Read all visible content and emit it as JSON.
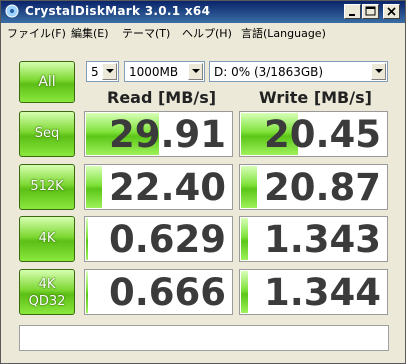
{
  "window": {
    "title": "CrystalDiskMark  3.0.1 x64"
  },
  "menu": [
    {
      "label": "ファイル(F)"
    },
    {
      "label": "編集(E)"
    },
    {
      "label": "テーマ(T)"
    },
    {
      "label": "ヘルプ(H)"
    },
    {
      "label": "言語(Language)"
    }
  ],
  "controls": {
    "all_label": "All",
    "count": "5",
    "size": "1000MB",
    "drive": "D: 0% (3/1863GB)"
  },
  "headers": {
    "read": "Read [MB/s]",
    "write": "Write [MB/s]"
  },
  "rows": [
    {
      "label": "Seq",
      "read": "29.91",
      "write": "20.45",
      "read_fill": 0.51,
      "write_fill": 0.4
    },
    {
      "label": "512K",
      "read": "22.40",
      "write": "20.87",
      "read_fill": 0.12,
      "write_fill": 0.12
    },
    {
      "label": "4K",
      "read": "0.629",
      "write": "1.343",
      "read_fill": 0.03,
      "write_fill": 0.06
    },
    {
      "label": "4K",
      "label2": "QD32",
      "read": "0.666",
      "write": "1.344",
      "read_fill": 0.03,
      "write_fill": 0.06
    }
  ],
  "comment": "",
  "colors": {
    "accent_green": "#7ed833",
    "title_bar": "#0a246a"
  }
}
